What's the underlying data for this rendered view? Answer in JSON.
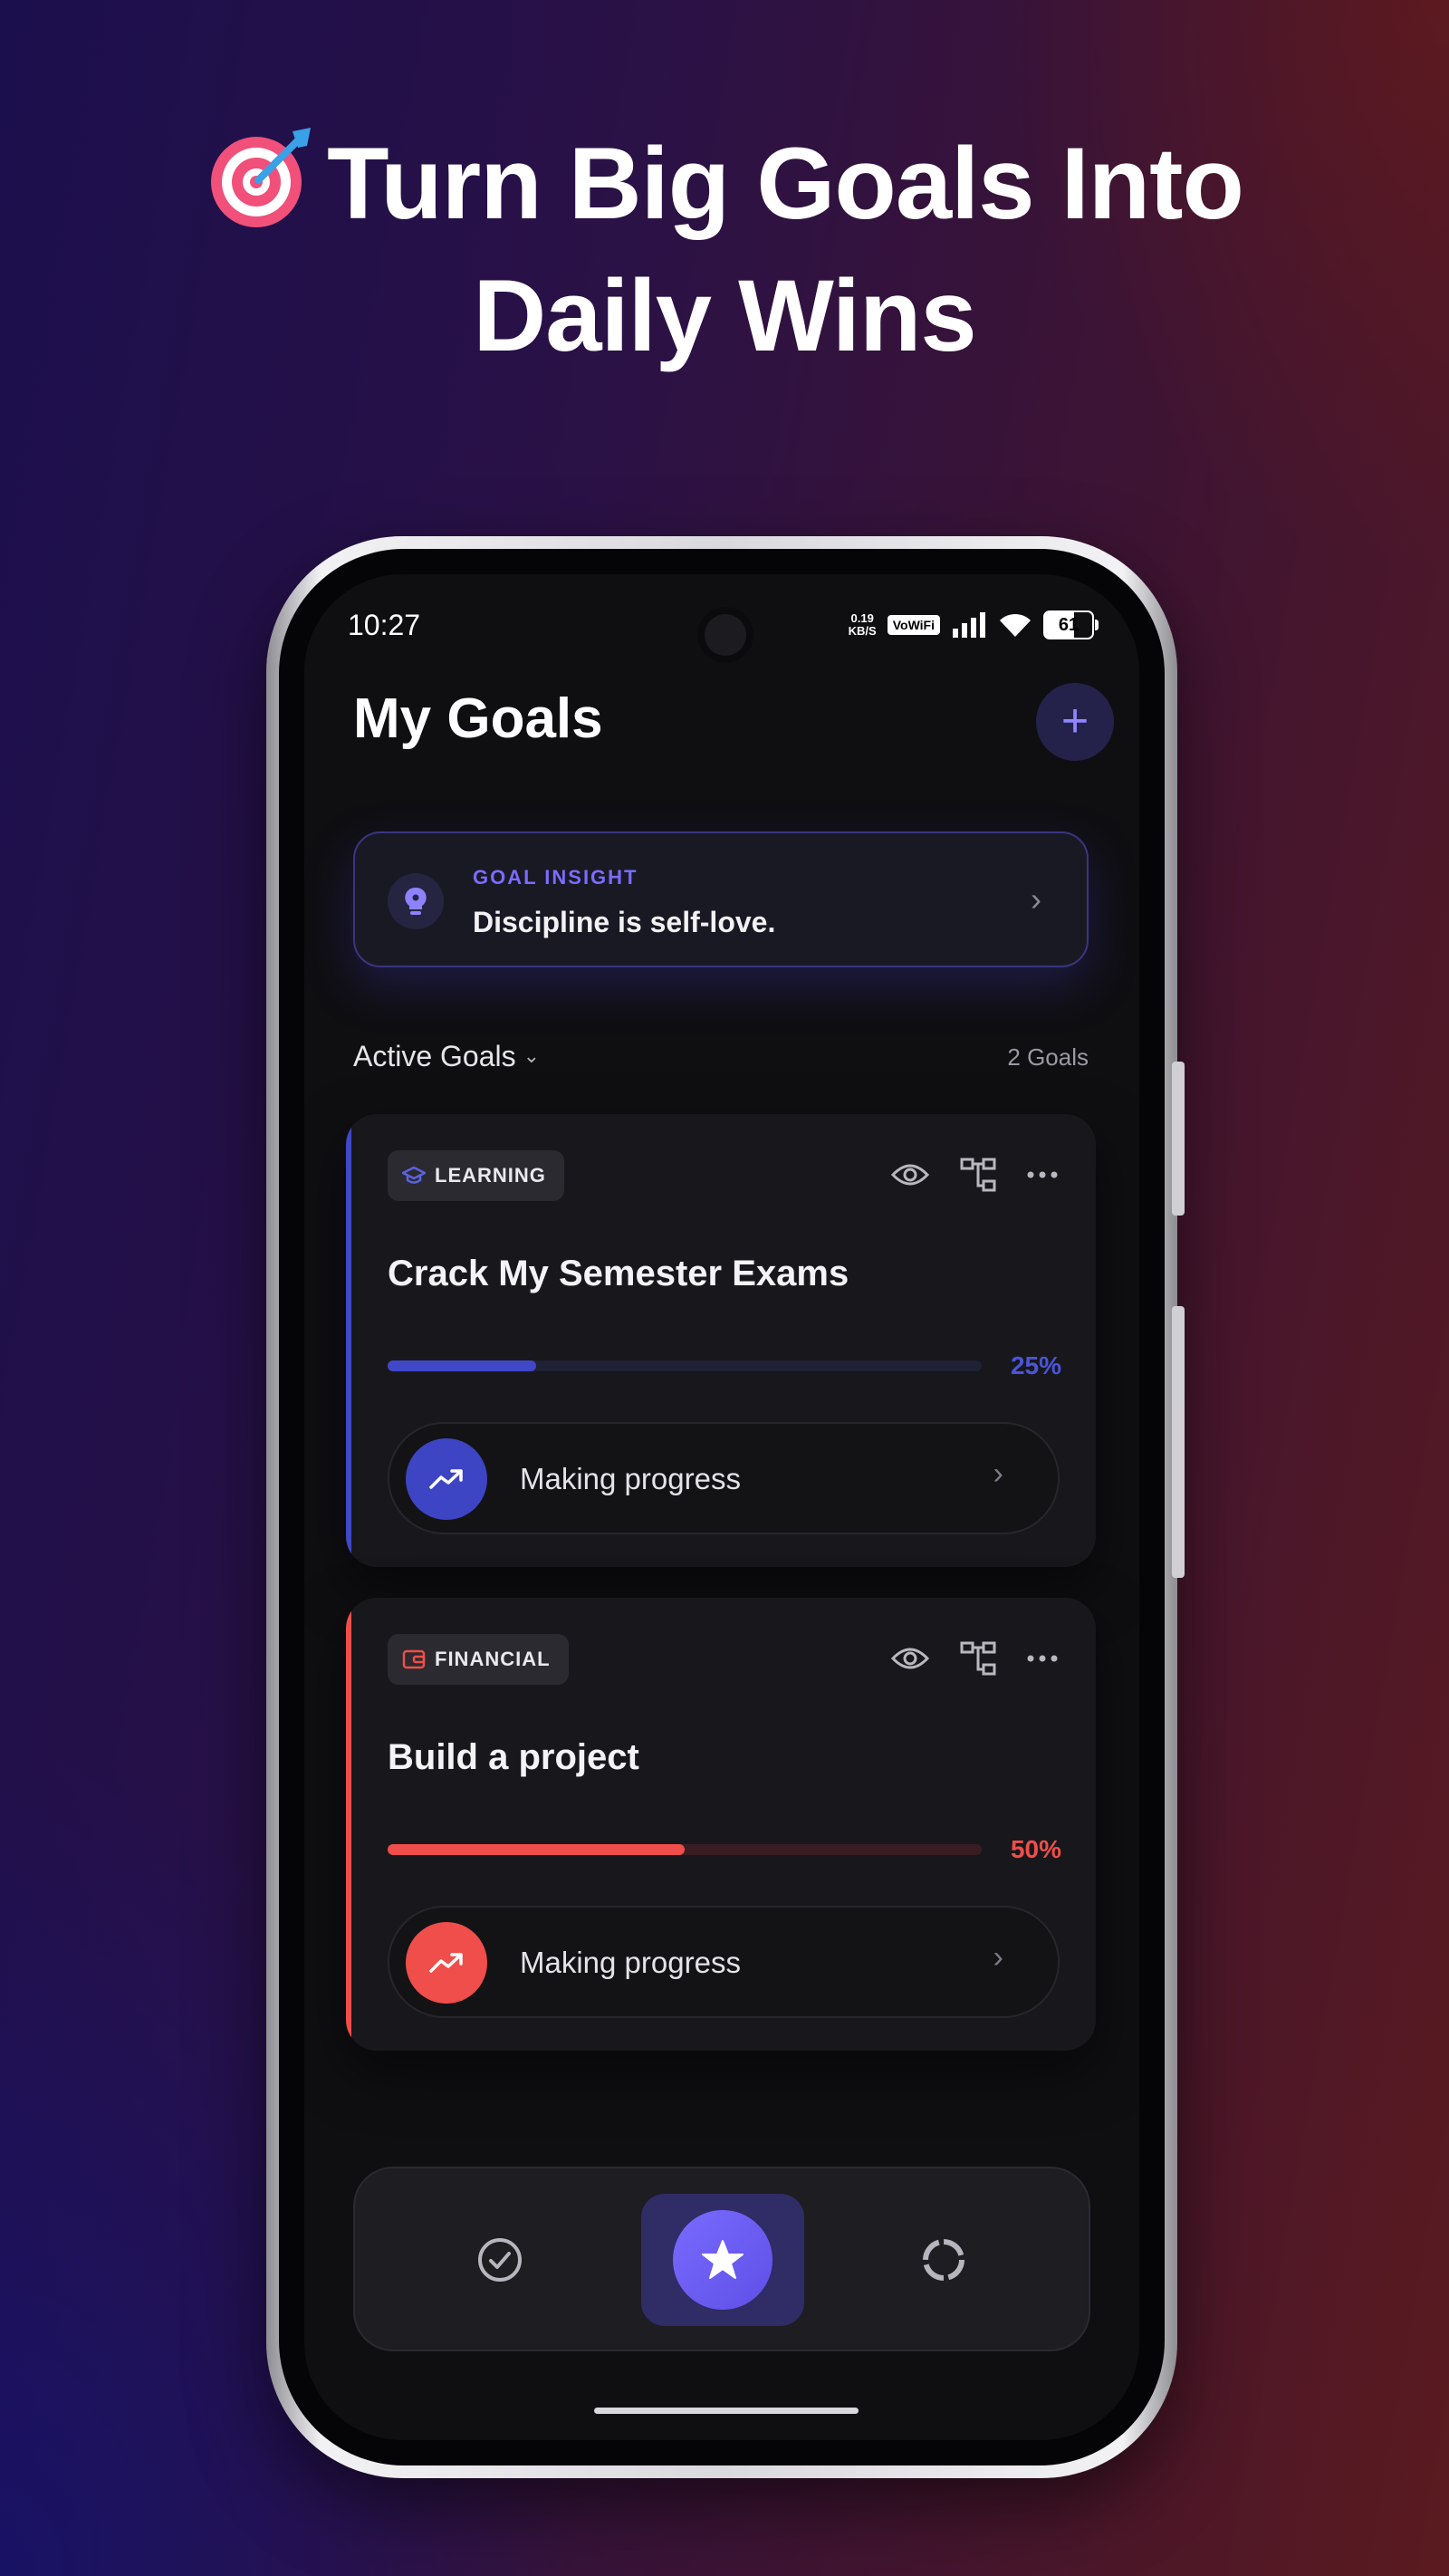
{
  "headline": {
    "line1": "Turn Big Goals Into",
    "line2": "Daily Wins"
  },
  "status_bar": {
    "time": "10:27",
    "net_speed_value": "0.19",
    "net_speed_unit": "KB/S",
    "vowifi": "VoWiFi",
    "battery": "61"
  },
  "header": {
    "title": "My Goals",
    "add_label": "+"
  },
  "insight": {
    "kicker": "GOAL INSIGHT",
    "quote": "Discipline is self-love."
  },
  "section": {
    "label": "Active Goals",
    "count": "2 Goals"
  },
  "goals": [
    {
      "category": "LEARNING",
      "title": "Crack My Semester Exams",
      "progress_percent": 25,
      "progress_label": "25%",
      "status": "Making progress",
      "accent": "#4048c8",
      "track": "#1f2135"
    },
    {
      "category": "FINANCIAL",
      "title": "Build a project",
      "progress_percent": 50,
      "progress_label": "50%",
      "status": "Making progress",
      "accent": "#ef4e4a",
      "track": "#3a1d22"
    }
  ],
  "colors": {
    "brand_purple": "#6c5ce7",
    "learning": "#4048c8",
    "financial": "#ef4e4a"
  },
  "icons": {
    "headline": "target-dart-icon",
    "insight": "lightbulb-icon",
    "card_actions": [
      "eye-icon",
      "hierarchy-icon",
      "more-dots-icon"
    ],
    "nav": [
      "check-circle-icon",
      "star-icon",
      "progress-ring-icon"
    ]
  }
}
